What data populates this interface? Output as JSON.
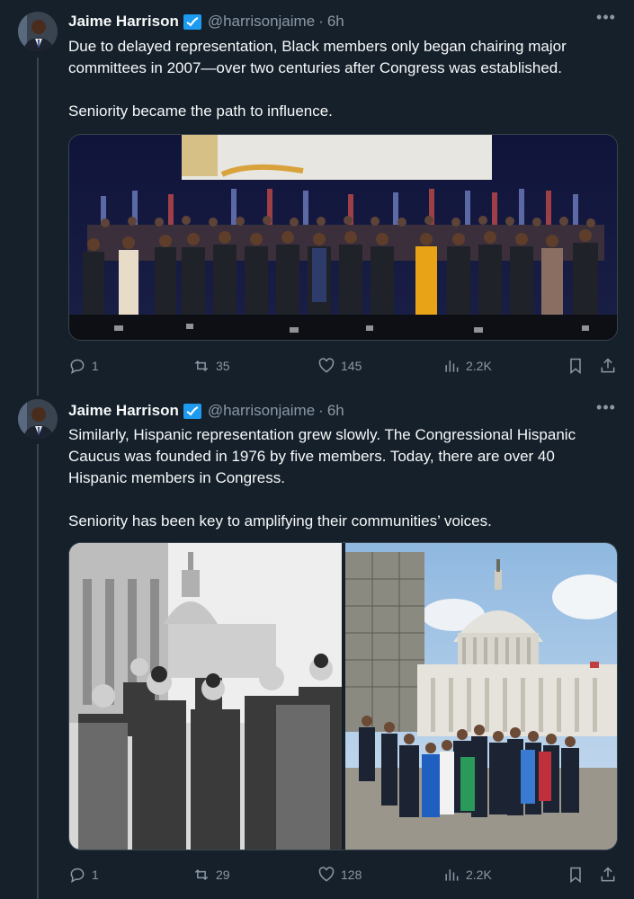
{
  "tweets": [
    {
      "author": {
        "name": "Jaime Harrison",
        "handle": "@harrisonjaime",
        "verified_icon": "verified-badge-icon"
      },
      "time": "6h",
      "paragraphs": [
        "Due to delayed representation, Black members only began chairing major committees in 2007—over two centuries after Congress was established.",
        "Seniority became the path to influence."
      ],
      "media": [
        {
          "description_icon": "swearing-in-ceremony-photo"
        }
      ],
      "stats": {
        "replies": "1",
        "reposts": "35",
        "likes": "145",
        "views": "2.2K"
      }
    },
    {
      "author": {
        "name": "Jaime Harrison",
        "handle": "@harrisonjaime",
        "verified_icon": "verified-badge-icon"
      },
      "time": "6h",
      "paragraphs": [
        "Similarly, Hispanic representation grew slowly. The Congressional Hispanic Caucus was founded in 1976 by five members. Today, there are over 40 Hispanic members in Congress.",
        "Seniority has been key to amplifying their communities’ voices."
      ],
      "media": [
        {
          "description_icon": "historic-bw-group-photo"
        },
        {
          "description_icon": "capitol-group-photo"
        }
      ],
      "stats": {
        "replies": "1",
        "reposts": "29",
        "likes": "128",
        "views": "2.2K"
      }
    }
  ],
  "colors": {
    "background": "#15202b",
    "text": "#f7f9f9",
    "muted": "#8b98a5",
    "border": "#38444d",
    "verified": "#1d9bf0"
  }
}
